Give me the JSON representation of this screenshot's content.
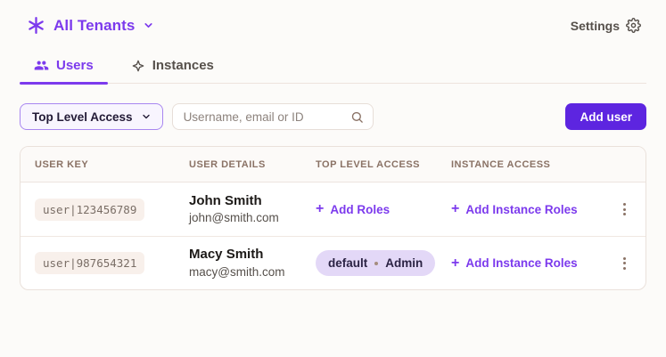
{
  "header": {
    "tenant_selector_label": "All Tenants",
    "settings_label": "Settings"
  },
  "tabs": [
    {
      "label": "Users",
      "icon": "users-icon",
      "active": true
    },
    {
      "label": "Instances",
      "icon": "sparkle-icon",
      "active": false
    }
  ],
  "toolbar": {
    "filter_label": "Top Level Access",
    "search_placeholder": "Username, email or ID",
    "add_user_label": "Add user"
  },
  "table": {
    "columns": [
      "USER KEY",
      "USER DETAILS",
      "TOP LEVEL ACCESS",
      "INSTANCE ACCESS"
    ],
    "rows": [
      {
        "user_key": "user|123456789",
        "name": "John Smith",
        "email": "john@smith.com",
        "top_level_access_action": "Add Roles",
        "instance_access_action": "Add Instance Roles"
      },
      {
        "user_key": "user|987654321",
        "name": "Macy Smith",
        "email": "macy@smith.com",
        "top_level_access_badge": {
          "parts": [
            "default",
            "Admin"
          ]
        },
        "instance_access_action": "Add Instance Roles"
      }
    ]
  },
  "colors": {
    "accent_purple": "#7C3AED",
    "button_purple": "#5D25E0",
    "badge_bg": "#E3D8F7",
    "page_bg": "#FCFBF9",
    "table_border": "#EAE1DB",
    "header_text": "#8A7265",
    "chip_bg": "#F8F0EB"
  }
}
